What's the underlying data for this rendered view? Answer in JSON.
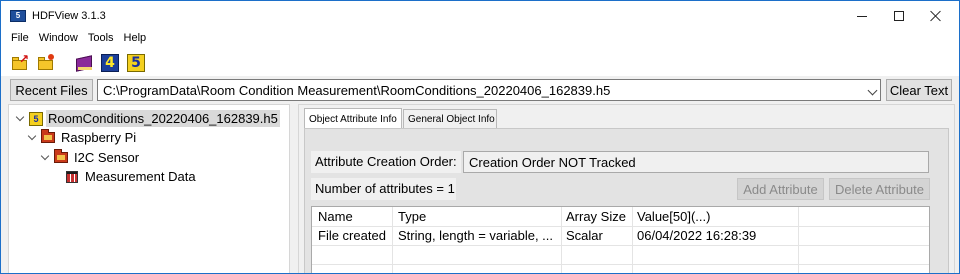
{
  "window": {
    "title": "HDFView 3.1.3",
    "app_icon_text": "5"
  },
  "menu": [
    "File",
    "Window",
    "Tools",
    "Help"
  ],
  "toolbar": {
    "icons": [
      "open-file-icon",
      "new-file-icon",
      "users-guide-icon",
      "hdf4-library-version-icon",
      "hdf5-library-version-icon"
    ],
    "h4_label": "4",
    "h5_label": "5"
  },
  "address_bar": {
    "recent_files_label": "Recent Files",
    "path": "C:\\ProgramData\\Room Condition Measurement\\RoomConditions_20220406_162839.h5",
    "clear_text_label": "Clear Text"
  },
  "tree": {
    "file": "RoomConditions_20220406_162839.h5",
    "file_badge": "5",
    "group1": "Raspberry Pi",
    "group2": "I2C Sensor",
    "dataset": "Measurement Data"
  },
  "tabs": {
    "object_attribute_info": "Object Attribute Info",
    "general_object_info": "General Object Info"
  },
  "attributes": {
    "creation_order_label": "Attribute Creation Order:",
    "creation_order_value": "Creation Order NOT Tracked",
    "count_text": "Number of attributes = 1",
    "add_label": "Add Attribute",
    "delete_label": "Delete Attribute",
    "columns": [
      "Name",
      "Type",
      "Array Size",
      "Value[50](...)"
    ],
    "rows": [
      [
        "File created",
        "String, length = variable, ...",
        "Scalar",
        "06/04/2022 16:28:39"
      ]
    ]
  },
  "colors": {
    "window_border": "#1c6fc9",
    "panel_bg": "#f0f0f0",
    "tab_page_bg": "#e3e3e3",
    "selection_bg": "#d9d9d9"
  }
}
